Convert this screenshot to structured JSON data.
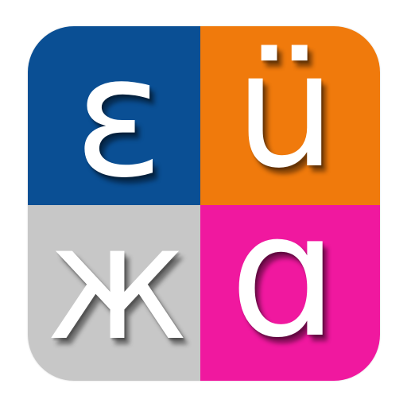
{
  "app_icon": {
    "tiles": [
      {
        "letter": "ɛ",
        "color": "#0a4f94"
      },
      {
        "letter": "ü",
        "color": "#f07a0c"
      },
      {
        "letter": "ж",
        "color": "#c7c7c7"
      },
      {
        "letter": "ɑ",
        "color": "#f0189f"
      }
    ]
  }
}
